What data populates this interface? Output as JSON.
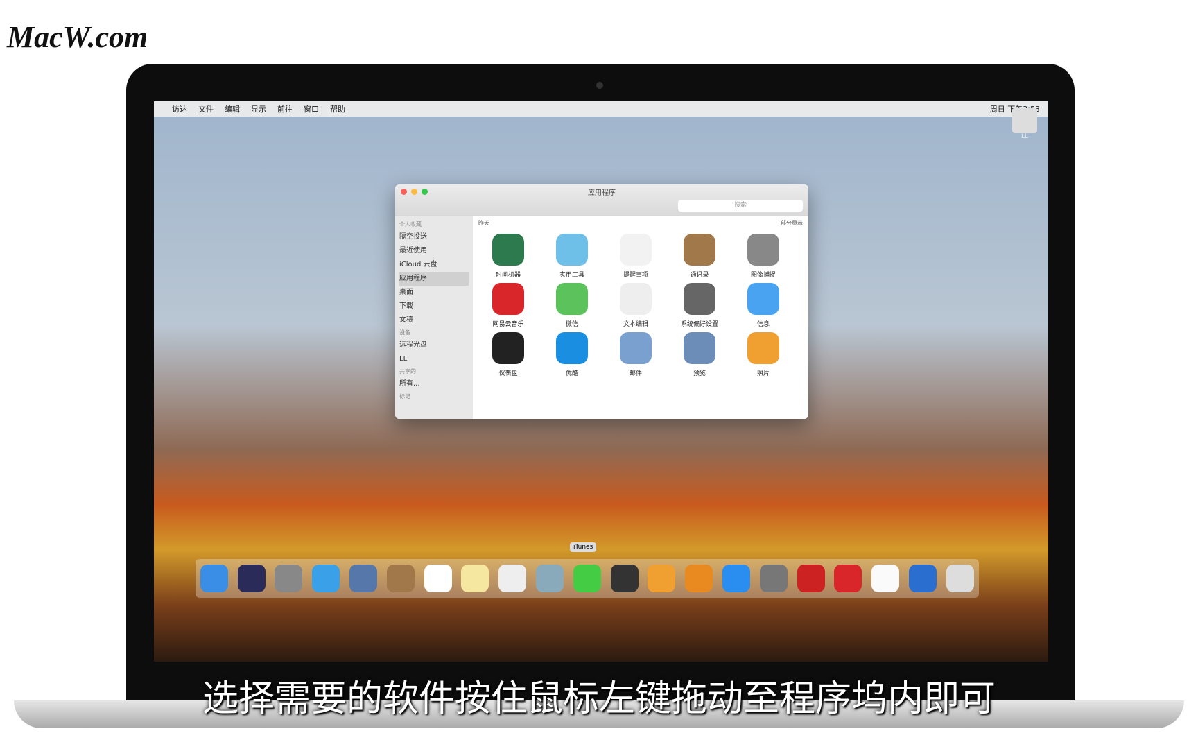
{
  "logo": "MacW.com",
  "menubar": {
    "items": [
      "访达",
      "文件",
      "编辑",
      "显示",
      "前往",
      "窗口",
      "帮助"
    ],
    "clock": "周日 下午3:53"
  },
  "finder": {
    "title": "应用程序",
    "search": "搜索",
    "group": "昨天",
    "share": "部分显示",
    "sidebar": [
      {
        "h": "个人收藏"
      },
      {
        "t": "隔空投送"
      },
      {
        "t": "最近使用"
      },
      {
        "t": "iCloud 云盘"
      },
      {
        "t": "应用程序"
      },
      {
        "t": "桌面"
      },
      {
        "t": "下载"
      },
      {
        "t": "文稿"
      },
      {
        "h": "设备"
      },
      {
        "t": "远程光盘"
      },
      {
        "t": "LL"
      },
      {
        "h": "共享的"
      },
      {
        "t": "所有..."
      },
      {
        "h": "标记"
      }
    ],
    "apps": [
      {
        "n": "时间机器",
        "c": "#2d7a4f"
      },
      {
        "n": "实用工具",
        "c": "#6ec0e8"
      },
      {
        "n": "提醒事项",
        "c": "#f2f2f2"
      },
      {
        "n": "通讯录",
        "c": "#a0784a"
      },
      {
        "n": "图像捕捉",
        "c": "#888"
      },
      {
        "n": "网易云音乐",
        "c": "#d8262a"
      },
      {
        "n": "微信",
        "c": "#5cc25c"
      },
      {
        "n": "文本编辑",
        "c": "#eee"
      },
      {
        "n": "系统偏好设置",
        "c": "#666"
      },
      {
        "n": "信息",
        "c": "#4aa3f0"
      },
      {
        "n": "仪表盘",
        "c": "#222"
      },
      {
        "n": "优酷",
        "c": "#1a8ee1"
      },
      {
        "n": "邮件",
        "c": "#7aa0d0"
      },
      {
        "n": "预览",
        "c": "#6b8db8"
      },
      {
        "n": "照片",
        "c": "#f0a030"
      }
    ]
  },
  "desktop": {
    "disk": "LL",
    "dock_tooltip": "iTunes"
  },
  "caption": "选择需要的软件按住鼠标左键拖动至程序坞内即可",
  "colors": {
    "close": "#fc605b",
    "min": "#fdbc40",
    "max": "#34c84a"
  }
}
